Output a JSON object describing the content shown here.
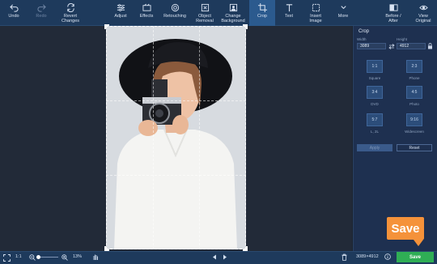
{
  "toolbar": {
    "undo": "Undo",
    "redo": "Redo",
    "revert_changes": "Revert\nChanges",
    "adjust": "Adjust",
    "effects": "Effects",
    "retouching": "Retouching",
    "object_removal": "Object\nRemoval",
    "change_background": "Change\nBackground",
    "crop": "Crop",
    "text": "Text",
    "insert_image": "Insert\nImage",
    "more": "More",
    "before_after": "Before /\nAfter",
    "view_original": "View\nOriginal"
  },
  "panel": {
    "title": "Crop",
    "width_label": "Width",
    "height_label": "Height",
    "width_value": "3089",
    "height_value": "4912",
    "ratios": [
      {
        "value": "1:1",
        "label": "Square"
      },
      {
        "value": "2:3",
        "label": "Phone"
      },
      {
        "value": "3:4",
        "label": "DVD"
      },
      {
        "value": "4:5",
        "label": "Photo"
      },
      {
        "value": "5:7",
        "label": "L, 2L"
      },
      {
        "value": "9:16",
        "label": "Widescreen"
      }
    ],
    "apply": "Apply",
    "reset": "Reset"
  },
  "statusbar": {
    "one_to_one": "1:1",
    "zoom": "13%",
    "dimensions": "3089×4912",
    "save": "Save"
  },
  "callout": {
    "save": "Save"
  },
  "colors": {
    "toolbar_bg": "#1e3a5c",
    "active_tool": "#2b5a8e",
    "save_green": "#2fae55",
    "callout_orange": "#f5923a"
  }
}
